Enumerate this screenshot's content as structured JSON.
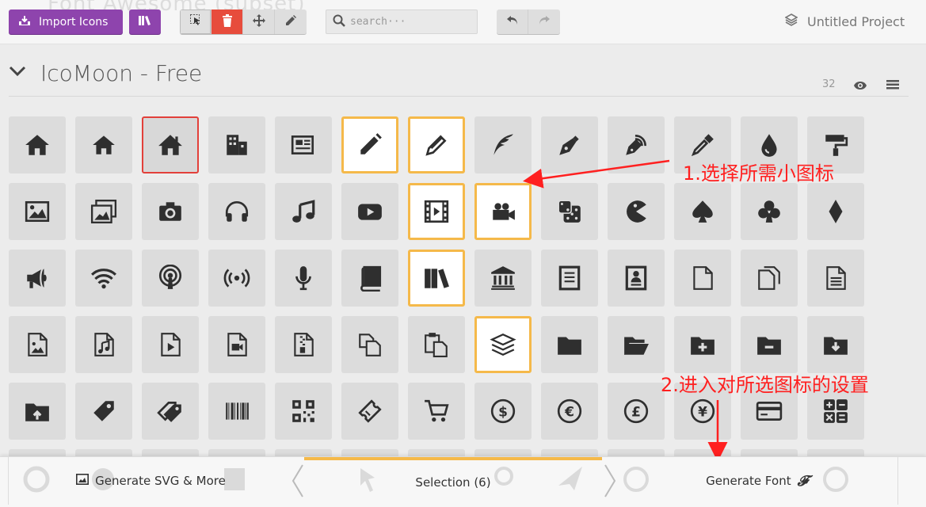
{
  "toolbar": {
    "import_label": "Import Icons",
    "search_placeholder": "search···",
    "project_name": "Untitled Project",
    "background_text": "Font Awesome (subset)"
  },
  "set": {
    "title": "IcoMoon - Free",
    "count": "32"
  },
  "grid": {
    "rows": [
      [
        {
          "icon": "home-icon"
        },
        {
          "icon": "home2-icon"
        },
        {
          "icon": "home3-icon",
          "state": "focus"
        },
        {
          "icon": "office-icon"
        },
        {
          "icon": "newspaper-icon"
        },
        {
          "icon": "pencil-icon",
          "state": "selected"
        },
        {
          "icon": "pencil2-icon",
          "state": "selected"
        },
        {
          "icon": "quill-icon"
        },
        {
          "icon": "pen-icon"
        },
        {
          "icon": "blog-icon"
        },
        {
          "icon": "eyedropper-icon"
        },
        {
          "icon": "droplet-icon"
        },
        {
          "icon": "paint-format-icon"
        }
      ],
      [
        {
          "icon": "image-icon"
        },
        {
          "icon": "images-icon"
        },
        {
          "icon": "camera-icon"
        },
        {
          "icon": "headphones-icon"
        },
        {
          "icon": "music-icon"
        },
        {
          "icon": "play-icon"
        },
        {
          "icon": "film-icon",
          "state": "selected"
        },
        {
          "icon": "video-camera-icon",
          "state": "selected"
        },
        {
          "icon": "dice-icon"
        },
        {
          "icon": "pacman-icon"
        },
        {
          "icon": "spades-icon"
        },
        {
          "icon": "clubs-icon"
        },
        {
          "icon": "diamonds-icon"
        }
      ],
      [
        {
          "icon": "bullhorn-icon"
        },
        {
          "icon": "connection-icon"
        },
        {
          "icon": "podcast-icon"
        },
        {
          "icon": "feed-icon"
        },
        {
          "icon": "mic-icon"
        },
        {
          "icon": "book-icon"
        },
        {
          "icon": "books-icon",
          "state": "selected"
        },
        {
          "icon": "library-icon"
        },
        {
          "icon": "file-text-icon"
        },
        {
          "icon": "profile-icon"
        },
        {
          "icon": "file-empty-icon"
        },
        {
          "icon": "files-empty-icon"
        },
        {
          "icon": "file-text2-icon"
        }
      ],
      [
        {
          "icon": "file-picture-icon"
        },
        {
          "icon": "file-music-icon"
        },
        {
          "icon": "file-play-icon"
        },
        {
          "icon": "file-video-icon"
        },
        {
          "icon": "file-zip-icon"
        },
        {
          "icon": "copy-icon"
        },
        {
          "icon": "paste-icon"
        },
        {
          "icon": "stack-icon",
          "state": "selected"
        },
        {
          "icon": "folder-icon"
        },
        {
          "icon": "folder-open-icon"
        },
        {
          "icon": "folder-plus-icon"
        },
        {
          "icon": "folder-minus-icon"
        },
        {
          "icon": "folder-download-icon"
        }
      ],
      [
        {
          "icon": "folder-upload-icon"
        },
        {
          "icon": "price-tag-icon"
        },
        {
          "icon": "price-tags-icon"
        },
        {
          "icon": "barcode-icon"
        },
        {
          "icon": "qrcode-icon"
        },
        {
          "icon": "ticket-icon"
        },
        {
          "icon": "cart-icon"
        },
        {
          "icon": "coin-dollar-icon"
        },
        {
          "icon": "coin-euro-icon"
        },
        {
          "icon": "coin-pound-icon"
        },
        {
          "icon": "coin-yen-icon"
        },
        {
          "icon": "credit-card-icon"
        },
        {
          "icon": "calculator-icon"
        }
      ]
    ]
  },
  "annotations": {
    "step1": "1.选择所需小图标",
    "step2": "2.进入对所选图标的设置",
    "color": "#ff2020"
  },
  "bottombar": {
    "generate_svg_label": "Generate SVG & More",
    "selection_label": "Selection (6)",
    "generate_font_label": "Generate Font"
  },
  "colors": {
    "brand_purple": "#8e44ad",
    "delete_red": "#e74c3c",
    "selection_orange": "#f5b94a",
    "focus_red": "#e2403a"
  }
}
